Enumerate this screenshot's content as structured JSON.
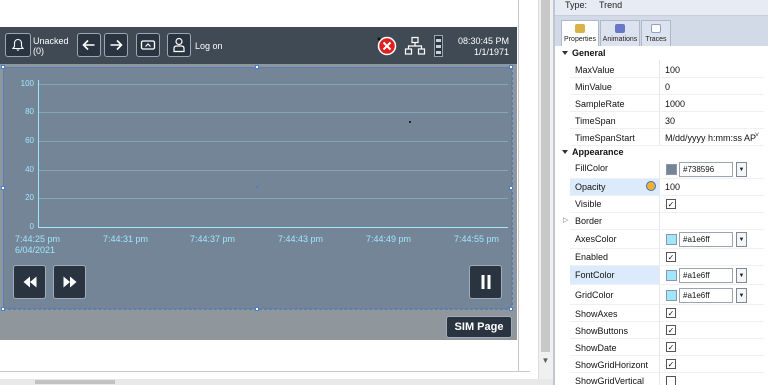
{
  "hmi": {
    "alarm": {
      "label": "Unacked",
      "count": "(0)"
    },
    "logon_label": "Log on",
    "time": "08:30:45 PM",
    "date": "1/1/1971",
    "sim_page_label": "SIM Page"
  },
  "trend": {
    "y_ticks": [
      "100",
      "80",
      "60",
      "40",
      "20",
      "0"
    ],
    "x_ticks": [
      "7:44:25 pm",
      "7:44:31 pm",
      "7:44:37 pm",
      "7:44:43 pm",
      "7:44:49 pm",
      "7:44:55 pm"
    ],
    "start_date": "6/04/2021",
    "axes_color": "#a1e6ff",
    "fill_color": "#738596"
  },
  "panel": {
    "type_label": "Type:",
    "type_value": "Trend",
    "tabs": [
      "Properties",
      "Animations",
      "Traces"
    ],
    "categories": {
      "general": "General",
      "appearance": "Appearance"
    },
    "general": [
      {
        "name": "MaxValue",
        "value": "100"
      },
      {
        "name": "MinValue",
        "value": "0"
      },
      {
        "name": "SampleRate",
        "value": "1000"
      },
      {
        "name": "TimeSpan",
        "value": "30"
      },
      {
        "name": "TimeSpanStart",
        "value": "M/dd/yyyy h:mm:ss AP"
      }
    ],
    "appearance": {
      "fill_color": {
        "name": "FillColor",
        "value": "#738596",
        "swatch": "#738596"
      },
      "opacity": {
        "name": "Opacity",
        "value": "100"
      },
      "visible": {
        "name": "Visible",
        "checked": true
      },
      "border": {
        "name": "Border"
      },
      "axes_color": {
        "name": "AxesColor",
        "value": "#a1e6ff",
        "swatch": "#a1e6ff"
      },
      "enabled": {
        "name": "Enabled",
        "checked": true
      },
      "font_color": {
        "name": "FontColor",
        "value": "#a1e6ff",
        "swatch": "#a1e6ff"
      },
      "grid_color": {
        "name": "GridColor",
        "value": "#a1e6ff",
        "swatch": "#a1e6ff"
      },
      "show_axes": {
        "name": "ShowAxes",
        "checked": true
      },
      "show_buttons": {
        "name": "ShowButtons",
        "checked": true
      },
      "show_date": {
        "name": "ShowDate",
        "checked": true
      },
      "show_grid_horizontal": {
        "name": "ShowGridHorizont",
        "checked": true
      },
      "show_grid_vertical": {
        "name": "ShowGridVertical",
        "checked": false
      }
    }
  }
}
